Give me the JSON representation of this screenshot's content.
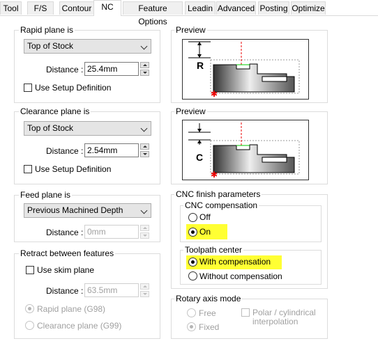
{
  "tabs": [
    "Tool",
    "F/S",
    "Contour",
    "NC",
    "Feature Options",
    "Leadin",
    "Advanced",
    "Posting",
    "Optimize"
  ],
  "active_tab": "NC",
  "highlight_color": "#ffff33",
  "rapid": {
    "title": "Rapid plane is",
    "combo": "Top of Stock",
    "distance_label": "Distance :",
    "distance": "25.4mm",
    "setup_label": "Use Setup Definition",
    "setup_checked": false
  },
  "clearance": {
    "title": "Clearance plane is",
    "combo": "Top of Stock",
    "distance_label": "Distance :",
    "distance": "2.54mm",
    "setup_label": "Use Setup Definition",
    "setup_checked": false
  },
  "feed": {
    "title": "Feed plane is",
    "combo": "Previous Machined Depth",
    "distance_label": "Distance :",
    "distance": "0mm",
    "distance_enabled": false
  },
  "retract": {
    "title": "Retract between features",
    "skim_label": "Use skim plane",
    "skim_checked": false,
    "distance_label": "Distance :",
    "distance": "63.5mm",
    "options": [
      "Rapid plane (G98)",
      "Clearance plane (G99)"
    ],
    "selected": "Rapid plane (G98)"
  },
  "preview1": {
    "title": "Preview",
    "letter": "R"
  },
  "preview2": {
    "title": "Preview",
    "letter": "C"
  },
  "cnc_finish": {
    "title": "CNC finish parameters",
    "compensation_title": "CNC compensation",
    "compensation_options": [
      "Off",
      "On"
    ],
    "compensation_selected": "On",
    "toolpath_title": "Toolpath center",
    "toolpath_options": [
      "With compensation",
      "Without compensation"
    ],
    "toolpath_selected": "With compensation"
  },
  "rotary": {
    "title": "Rotary axis mode",
    "options": [
      "Free",
      "Fixed"
    ],
    "selected": "Fixed",
    "polar_label_line1": "Polar / cylindrical",
    "polar_label_line2": "interpolation",
    "polar_checked": false
  }
}
